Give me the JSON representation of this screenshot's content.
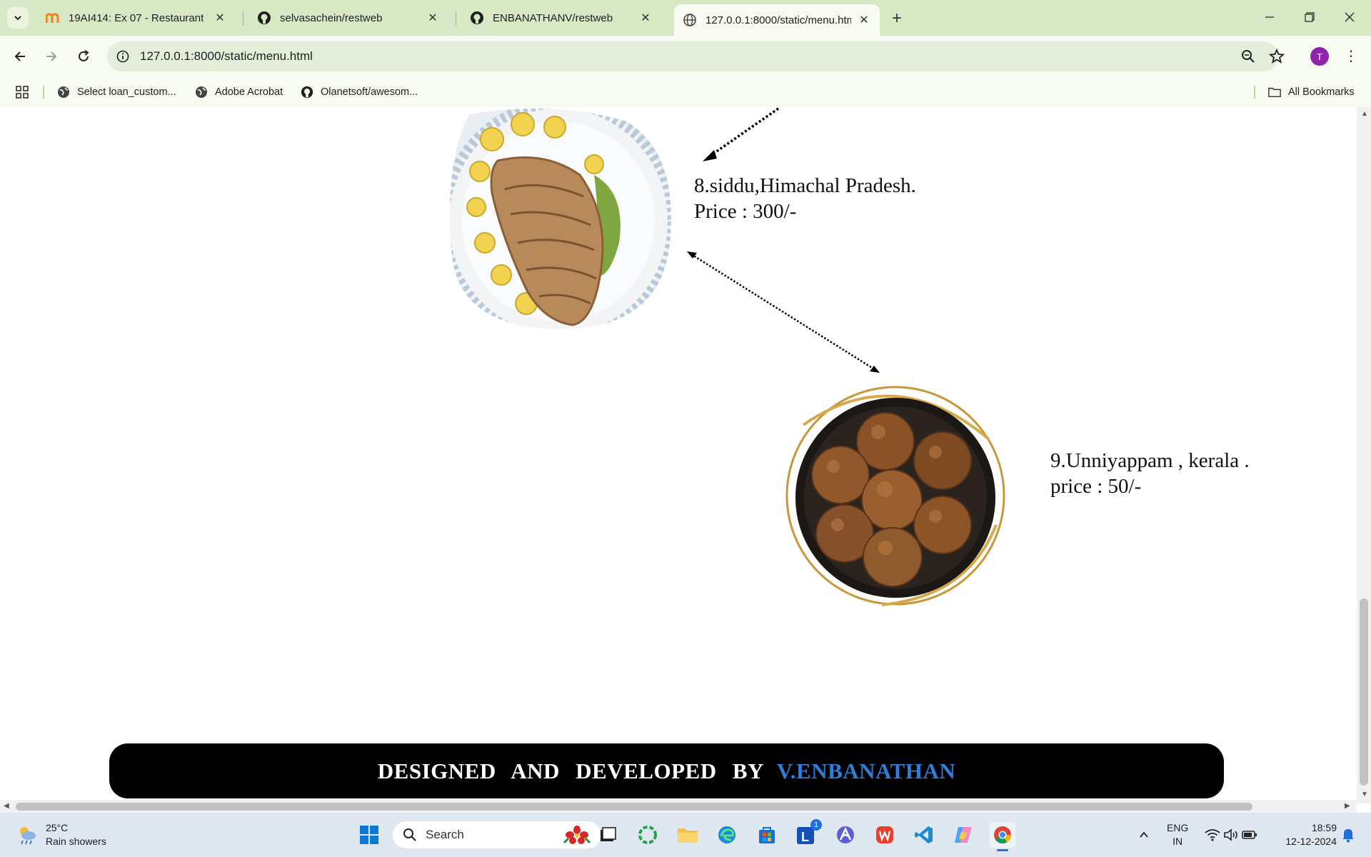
{
  "browser": {
    "tabs": [
      {
        "title": "19AI414: Ex 07 - Restaurant We",
        "icon": "moodle-icon"
      },
      {
        "title": "selvasachein/restweb",
        "icon": "github-icon"
      },
      {
        "title": "ENBANATHANV/restweb",
        "icon": "github-icon"
      },
      {
        "title": "127.0.0.1:8000/static/menu.htm",
        "icon": "globe-icon"
      }
    ],
    "url": "127.0.0.1:8000/static/menu.html",
    "profile_initial": "T",
    "bookmarks": [
      {
        "label": "Select loan_custom...",
        "icon": "globe-icon"
      },
      {
        "label": "Adobe Acrobat",
        "icon": "globe-icon"
      },
      {
        "label": "Olanetsoft/awesom...",
        "icon": "github-icon"
      }
    ],
    "all_bookmarks_label": "All Bookmarks"
  },
  "menu": {
    "dishes": [
      {
        "line1": "8.siddu,Himachal Pradesh.",
        "line2": "Price : 300/-"
      },
      {
        "line1": "9.Unniyappam , kerala .",
        "line2": "price : 50/-"
      }
    ]
  },
  "footer": {
    "prefix": "DESIGNED AND DEVELOPED BY",
    "name": "V.ENBANATHAN",
    "name_color": "#2f7ed8"
  },
  "taskbar": {
    "weather_temp": "25°C",
    "weather_desc": "Rain showers",
    "search_placeholder": "Search",
    "lang_line1": "ENG",
    "lang_line2": "IN",
    "time": "18:59",
    "date": "12-12-2024",
    "badge_count": "1"
  }
}
